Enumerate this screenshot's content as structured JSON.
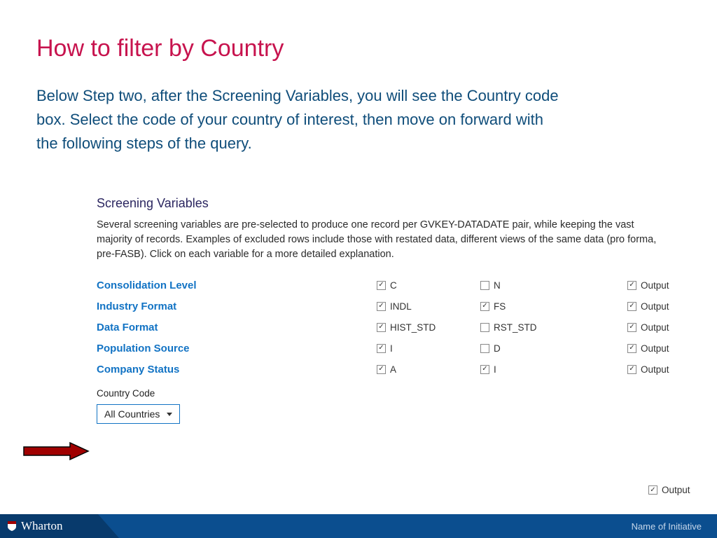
{
  "title": "How to filter by Country",
  "intro": "Below Step two, after the Screening Variables, you will see the Country code box. Select the code of your country of interest, then move on forward with the following steps of the query.",
  "panel": {
    "heading": "Screening Variables",
    "paragraph": "Several screening variables are pre-selected to produce one record per GVKEY-DATADATE pair, while keeping the vast majority of records. Examples of excluded rows include those with restated data, different views of the same data (pro forma, pre-FASB). Click on each variable for a more detailed explanation.",
    "rows": [
      {
        "label": "Consolidation Level",
        "opt1": {
          "text": "C",
          "checked": true
        },
        "opt2": {
          "text": "N",
          "checked": false
        },
        "out": {
          "text": "Output",
          "checked": true
        }
      },
      {
        "label": "Industry Format",
        "opt1": {
          "text": "INDL",
          "checked": true
        },
        "opt2": {
          "text": "FS",
          "checked": true
        },
        "out": {
          "text": "Output",
          "checked": true
        }
      },
      {
        "label": "Data Format",
        "opt1": {
          "text": "HIST_STD",
          "checked": true
        },
        "opt2": {
          "text": "RST_STD",
          "checked": false
        },
        "out": {
          "text": "Output",
          "checked": true
        }
      },
      {
        "label": "Population Source",
        "opt1": {
          "text": "I",
          "checked": true
        },
        "opt2": {
          "text": "D",
          "checked": false
        },
        "out": {
          "text": "Output",
          "checked": true
        }
      },
      {
        "label": "Company Status",
        "opt1": {
          "text": "A",
          "checked": true
        },
        "opt2": {
          "text": "I",
          "checked": true
        },
        "out": {
          "text": "Output",
          "checked": true
        }
      }
    ],
    "country_label": "Country Code",
    "dropdown_value": "All Countries",
    "bottom_output": {
      "text": "Output",
      "checked": true
    }
  },
  "footer": {
    "brand": "Wharton",
    "right": "Name of Initiative"
  }
}
